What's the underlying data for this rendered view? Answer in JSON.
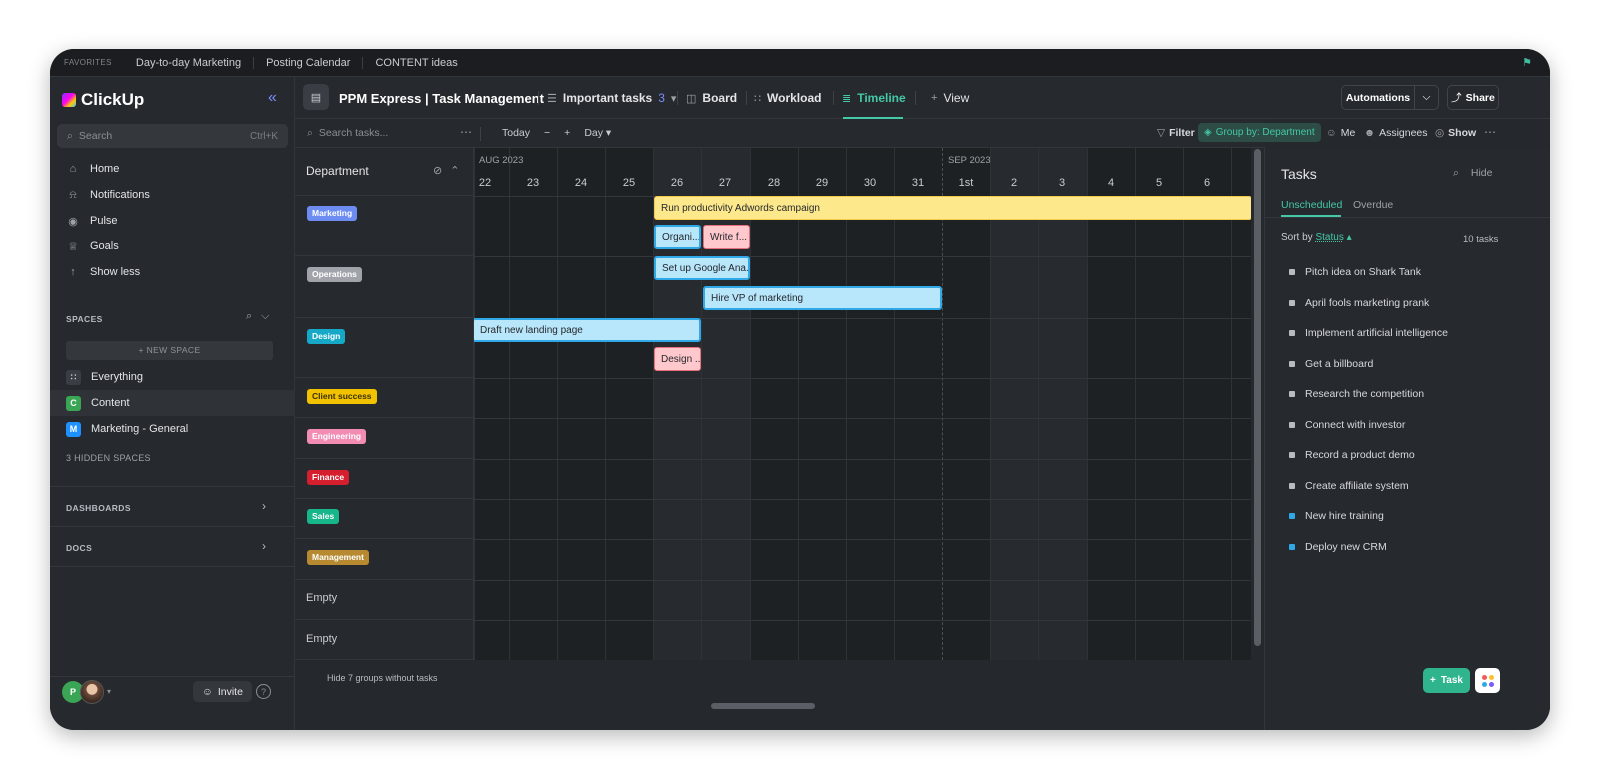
{
  "favorites": {
    "label": "FAVORITES",
    "items": [
      "Day-to-day Marketing",
      "Posting Calendar",
      "CONTENT ideas"
    ]
  },
  "sidebar": {
    "brand": "ClickUp",
    "search_placeholder": "Search",
    "search_shortcut": "Ctrl+K",
    "nav": [
      {
        "label": "Home",
        "icon": "home-icon"
      },
      {
        "label": "Notifications",
        "icon": "bell-icon"
      },
      {
        "label": "Pulse",
        "icon": "pulse-icon"
      },
      {
        "label": "Goals",
        "icon": "trophy-icon"
      },
      {
        "label": "Show less",
        "icon": "arrow-up-icon"
      }
    ],
    "spaces_label": "SPACES",
    "new_space": "+ NEW SPACE",
    "spaces": [
      {
        "label": "Everything",
        "badge": "",
        "color": "#3a3e44"
      },
      {
        "label": "Content",
        "badge": "C",
        "color": "#3aa655"
      },
      {
        "label": "Marketing - General",
        "badge": "M",
        "color": "#1e90ff"
      }
    ],
    "hidden_spaces": "3 HIDDEN SPACES",
    "dashboards": "DASHBOARDS",
    "docs": "DOCS",
    "avatar_initial": "P",
    "invite": "Invite",
    "help": "?"
  },
  "topbar": {
    "title": "PPM Express | Task Management",
    "views": [
      {
        "label": "Important tasks",
        "count": "3",
        "icon": "list-icon"
      },
      {
        "label": "Board",
        "icon": "board-icon"
      },
      {
        "label": "Workload",
        "icon": "workload-icon"
      },
      {
        "label": "Timeline",
        "icon": "timeline-icon"
      },
      {
        "label": "View",
        "icon": "plus-icon"
      }
    ],
    "automations": "Automations",
    "share": "Share"
  },
  "toolbar": {
    "search_placeholder": "Search tasks...",
    "today": "Today",
    "scale": "Day",
    "filter": "Filter",
    "group_by": "Group by: Department",
    "me": "Me",
    "assignees": "Assignees",
    "show": "Show"
  },
  "groups": {
    "header": "Department",
    "items": [
      {
        "label": "Marketing",
        "color": "#6d8cf2"
      },
      {
        "label": "Operations",
        "color": "#a0a4aa"
      },
      {
        "label": "Design",
        "color": "#15a9c7"
      },
      {
        "label": "Client success",
        "color": "#f2c200"
      },
      {
        "label": "Engineering",
        "color": "#f28cb3"
      },
      {
        "label": "Finance",
        "color": "#d61f2e"
      },
      {
        "label": "Sales",
        "color": "#17b58a"
      },
      {
        "label": "Management",
        "color": "#b78a32"
      }
    ],
    "empty": [
      "Empty",
      "Empty"
    ],
    "footer": "Hide 7 groups without tasks"
  },
  "timeline": {
    "months": [
      {
        "label": "AUG 2023"
      },
      {
        "label": "SEP 2023"
      }
    ],
    "days": [
      "22",
      "23",
      "24",
      "25",
      "26",
      "27",
      "28",
      "29",
      "30",
      "31",
      "1st",
      "2",
      "3",
      "4",
      "5",
      "6"
    ],
    "tasks": [
      {
        "label": "Run productivity Adwords campaign",
        "style": "yellow"
      },
      {
        "label": "Organi...",
        "style": "blue"
      },
      {
        "label": "Write f...",
        "style": "pink"
      },
      {
        "label": "Set up Google Ana...",
        "style": "blue"
      },
      {
        "label": "Hire VP of marketing",
        "style": "blue"
      },
      {
        "label": "Draft new landing page",
        "style": "blue"
      },
      {
        "label": "Design ...",
        "style": "pink"
      }
    ]
  },
  "tasks_panel": {
    "title": "Tasks",
    "hide": "Hide",
    "tabs": [
      "Unscheduled",
      "Overdue"
    ],
    "sort_label": "Sort by",
    "sort_field": "Status",
    "count": "10 tasks",
    "items": [
      {
        "label": "Pitch idea on Shark Tank",
        "status": "gray"
      },
      {
        "label": "April fools marketing prank",
        "status": "gray"
      },
      {
        "label": "Implement artificial intelligence",
        "status": "gray"
      },
      {
        "label": "Get a billboard",
        "status": "gray"
      },
      {
        "label": "Research the competition",
        "status": "gray"
      },
      {
        "label": "Connect with investor",
        "status": "gray"
      },
      {
        "label": "Record a product demo",
        "status": "gray"
      },
      {
        "label": "Create affiliate system",
        "status": "gray"
      },
      {
        "label": "New hire training",
        "status": "blue"
      },
      {
        "label": "Deploy new CRM",
        "status": "blue"
      }
    ],
    "add_task": "Task"
  },
  "accent_color": "#45c8a7"
}
